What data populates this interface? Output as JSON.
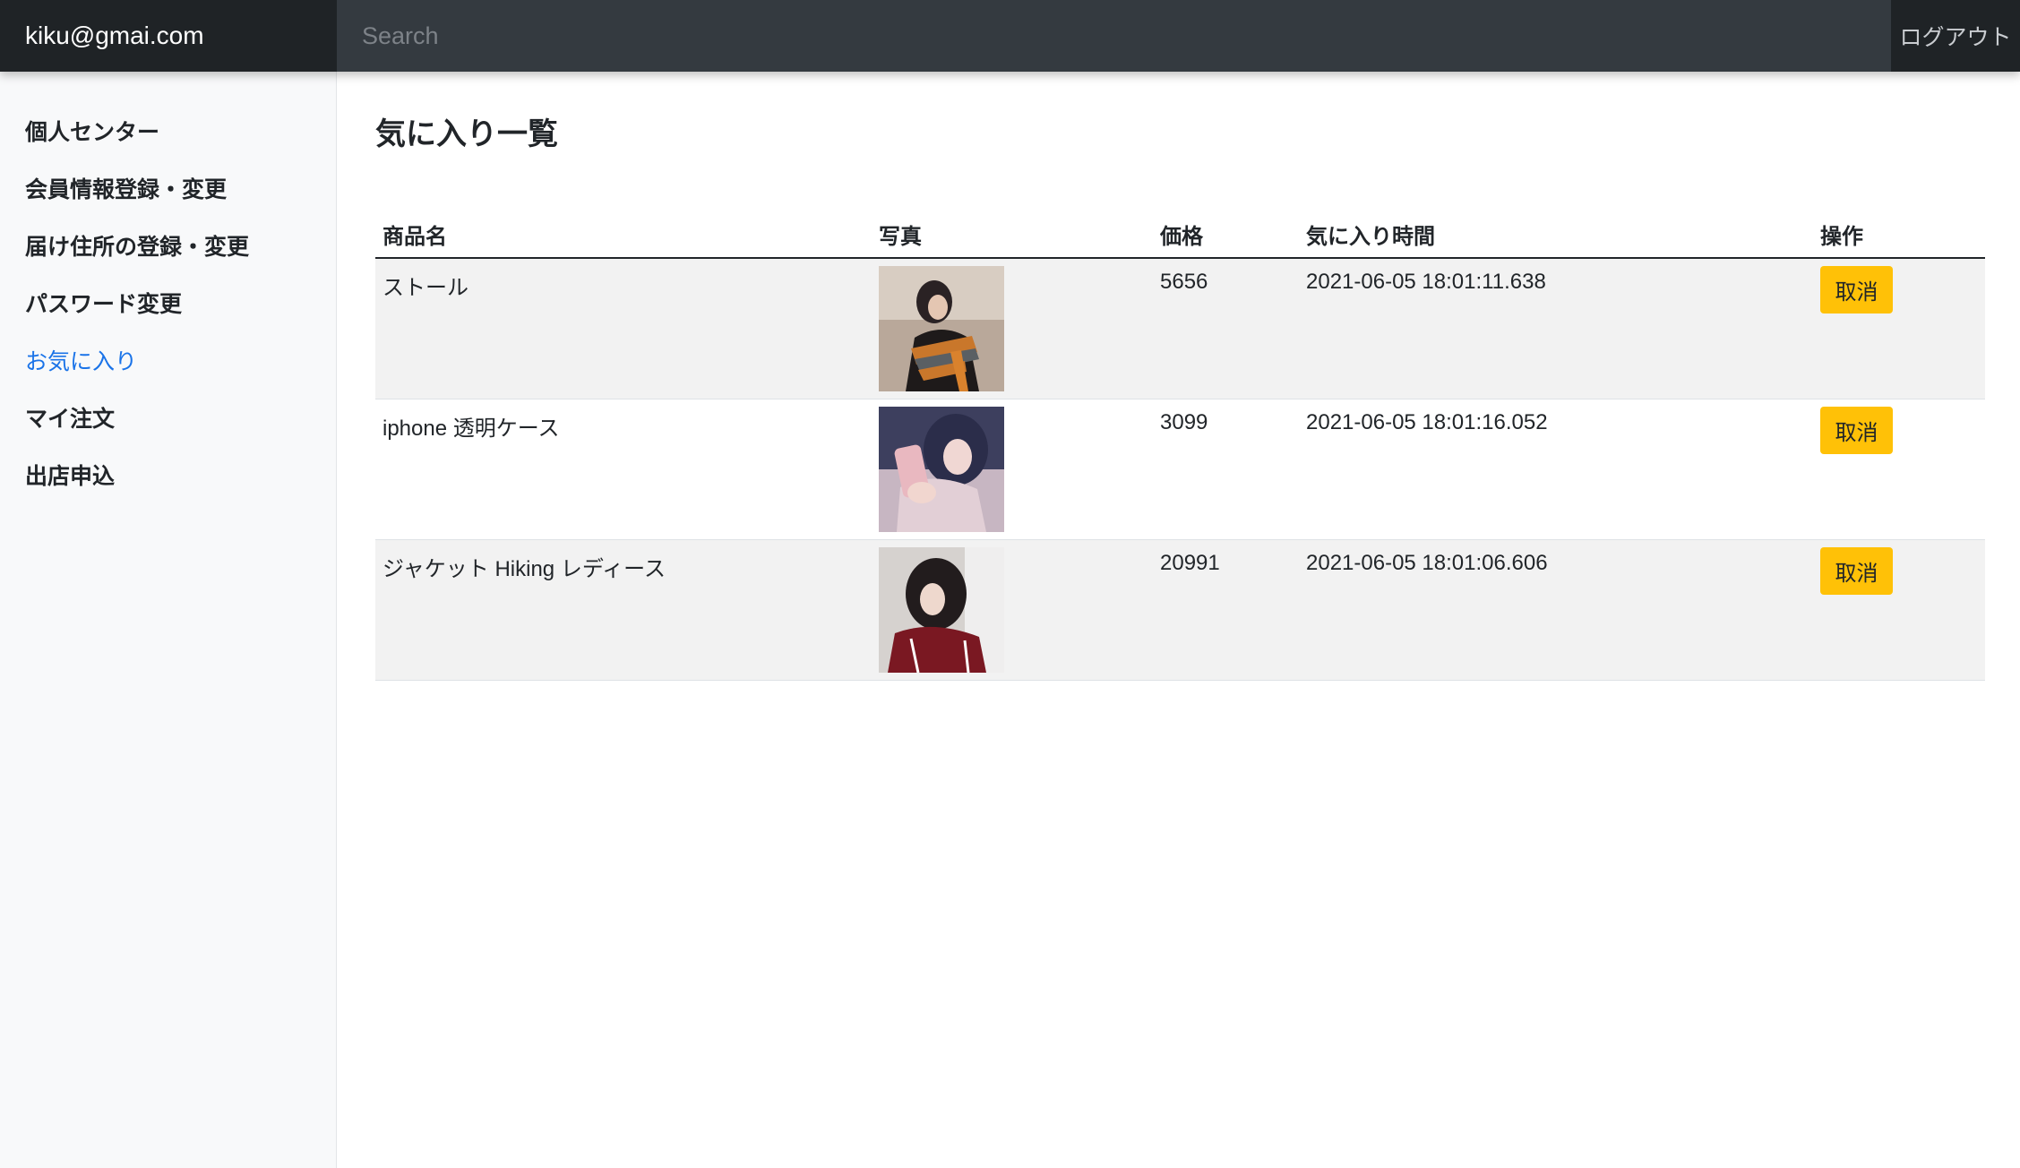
{
  "header": {
    "user_email": "kiku@gmai.com",
    "search_placeholder": "Search",
    "logout_label": "ログアウト"
  },
  "sidebar": {
    "items": [
      {
        "label": "個人センター",
        "active": false
      },
      {
        "label": "会員情報登録・変更",
        "active": false
      },
      {
        "label": "届け住所の登録・変更",
        "active": false
      },
      {
        "label": "パスワード変更",
        "active": false
      },
      {
        "label": "お気に入り",
        "active": true
      },
      {
        "label": "マイ注文",
        "active": false
      },
      {
        "label": "出店申込",
        "active": false
      }
    ]
  },
  "main": {
    "title": "気に入り一覧",
    "table": {
      "headers": [
        "商品名",
        "写真",
        "価格",
        "気に入り時間",
        "操作"
      ],
      "rows": [
        {
          "name": "ストール",
          "photo": "product-photo-stole",
          "price": "5656",
          "time": "2021-06-05 18:01:11.638",
          "action": "取消"
        },
        {
          "name": "iphone 透明ケース",
          "photo": "product-photo-iphone-case",
          "price": "3099",
          "time": "2021-06-05 18:01:16.052",
          "action": "取消"
        },
        {
          "name": "ジャケット Hiking レディース",
          "photo": "product-photo-jacket",
          "price": "20991",
          "time": "2021-06-05 18:01:06.606",
          "action": "取消"
        }
      ]
    }
  },
  "colors": {
    "navbar": "#343a40",
    "navbar_dark": "#1f2326",
    "sidebar_bg": "#f8f9fa",
    "active_link": "#1a73e8",
    "cancel_button": "#ffc107",
    "row_stripe": "#f2f2f2"
  }
}
